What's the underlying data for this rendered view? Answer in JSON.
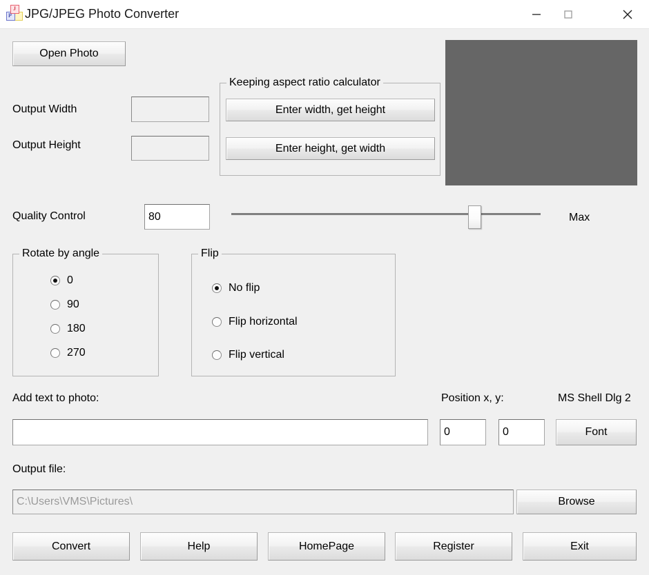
{
  "window": {
    "title": "JPG/JPEG Photo Converter",
    "icon": "app-photo-converter-icon",
    "minimize_label": "—",
    "maximize_label": "□",
    "close_label": "✕"
  },
  "toolbar": {
    "open_photo_label": "Open Photo"
  },
  "size": {
    "width_label": "Output Width",
    "width_value": "",
    "height_label": "Output Height",
    "height_value": ""
  },
  "aspect": {
    "group_title": "Keeping aspect ratio calculator",
    "enter_width_label": "Enter width, get height",
    "enter_height_label": "Enter height, get width"
  },
  "quality": {
    "label": "Quality Control",
    "value": "80",
    "max_label": "Max",
    "slider_min": 0,
    "slider_max": 100,
    "slider_value": 80
  },
  "rotate": {
    "group_title": "Rotate by angle",
    "selected": "0",
    "options": [
      {
        "label": "0",
        "checked": true
      },
      {
        "label": "90",
        "checked": false
      },
      {
        "label": "180",
        "checked": false
      },
      {
        "label": "270",
        "checked": false
      }
    ]
  },
  "flip": {
    "group_title": "Flip",
    "selected": "No flip",
    "options": [
      {
        "label": "No flip",
        "checked": true
      },
      {
        "label": "Flip horizontal",
        "checked": false
      },
      {
        "label": "Flip vertical",
        "checked": false
      }
    ]
  },
  "text_overlay": {
    "label": "Add text to photo:",
    "value": "",
    "position_label": "Position x, y:",
    "position_x": "0",
    "position_y": "0",
    "font_name": "MS Shell Dlg 2",
    "font_button_label": "Font"
  },
  "output": {
    "label": "Output file:",
    "path": "C:\\Users\\VMS\\Pictures\\",
    "browse_label": "Browse"
  },
  "actions": {
    "convert_label": "Convert",
    "help_label": "Help",
    "homepage_label": "HomePage",
    "register_label": "Register",
    "exit_label": "Exit"
  },
  "colors": {
    "dialog_background": "#f0f0f0",
    "titlebar_background": "#ffffff",
    "preview_background": "#666666",
    "text": "#000000",
    "placeholder_text": "#9a9a9a"
  }
}
